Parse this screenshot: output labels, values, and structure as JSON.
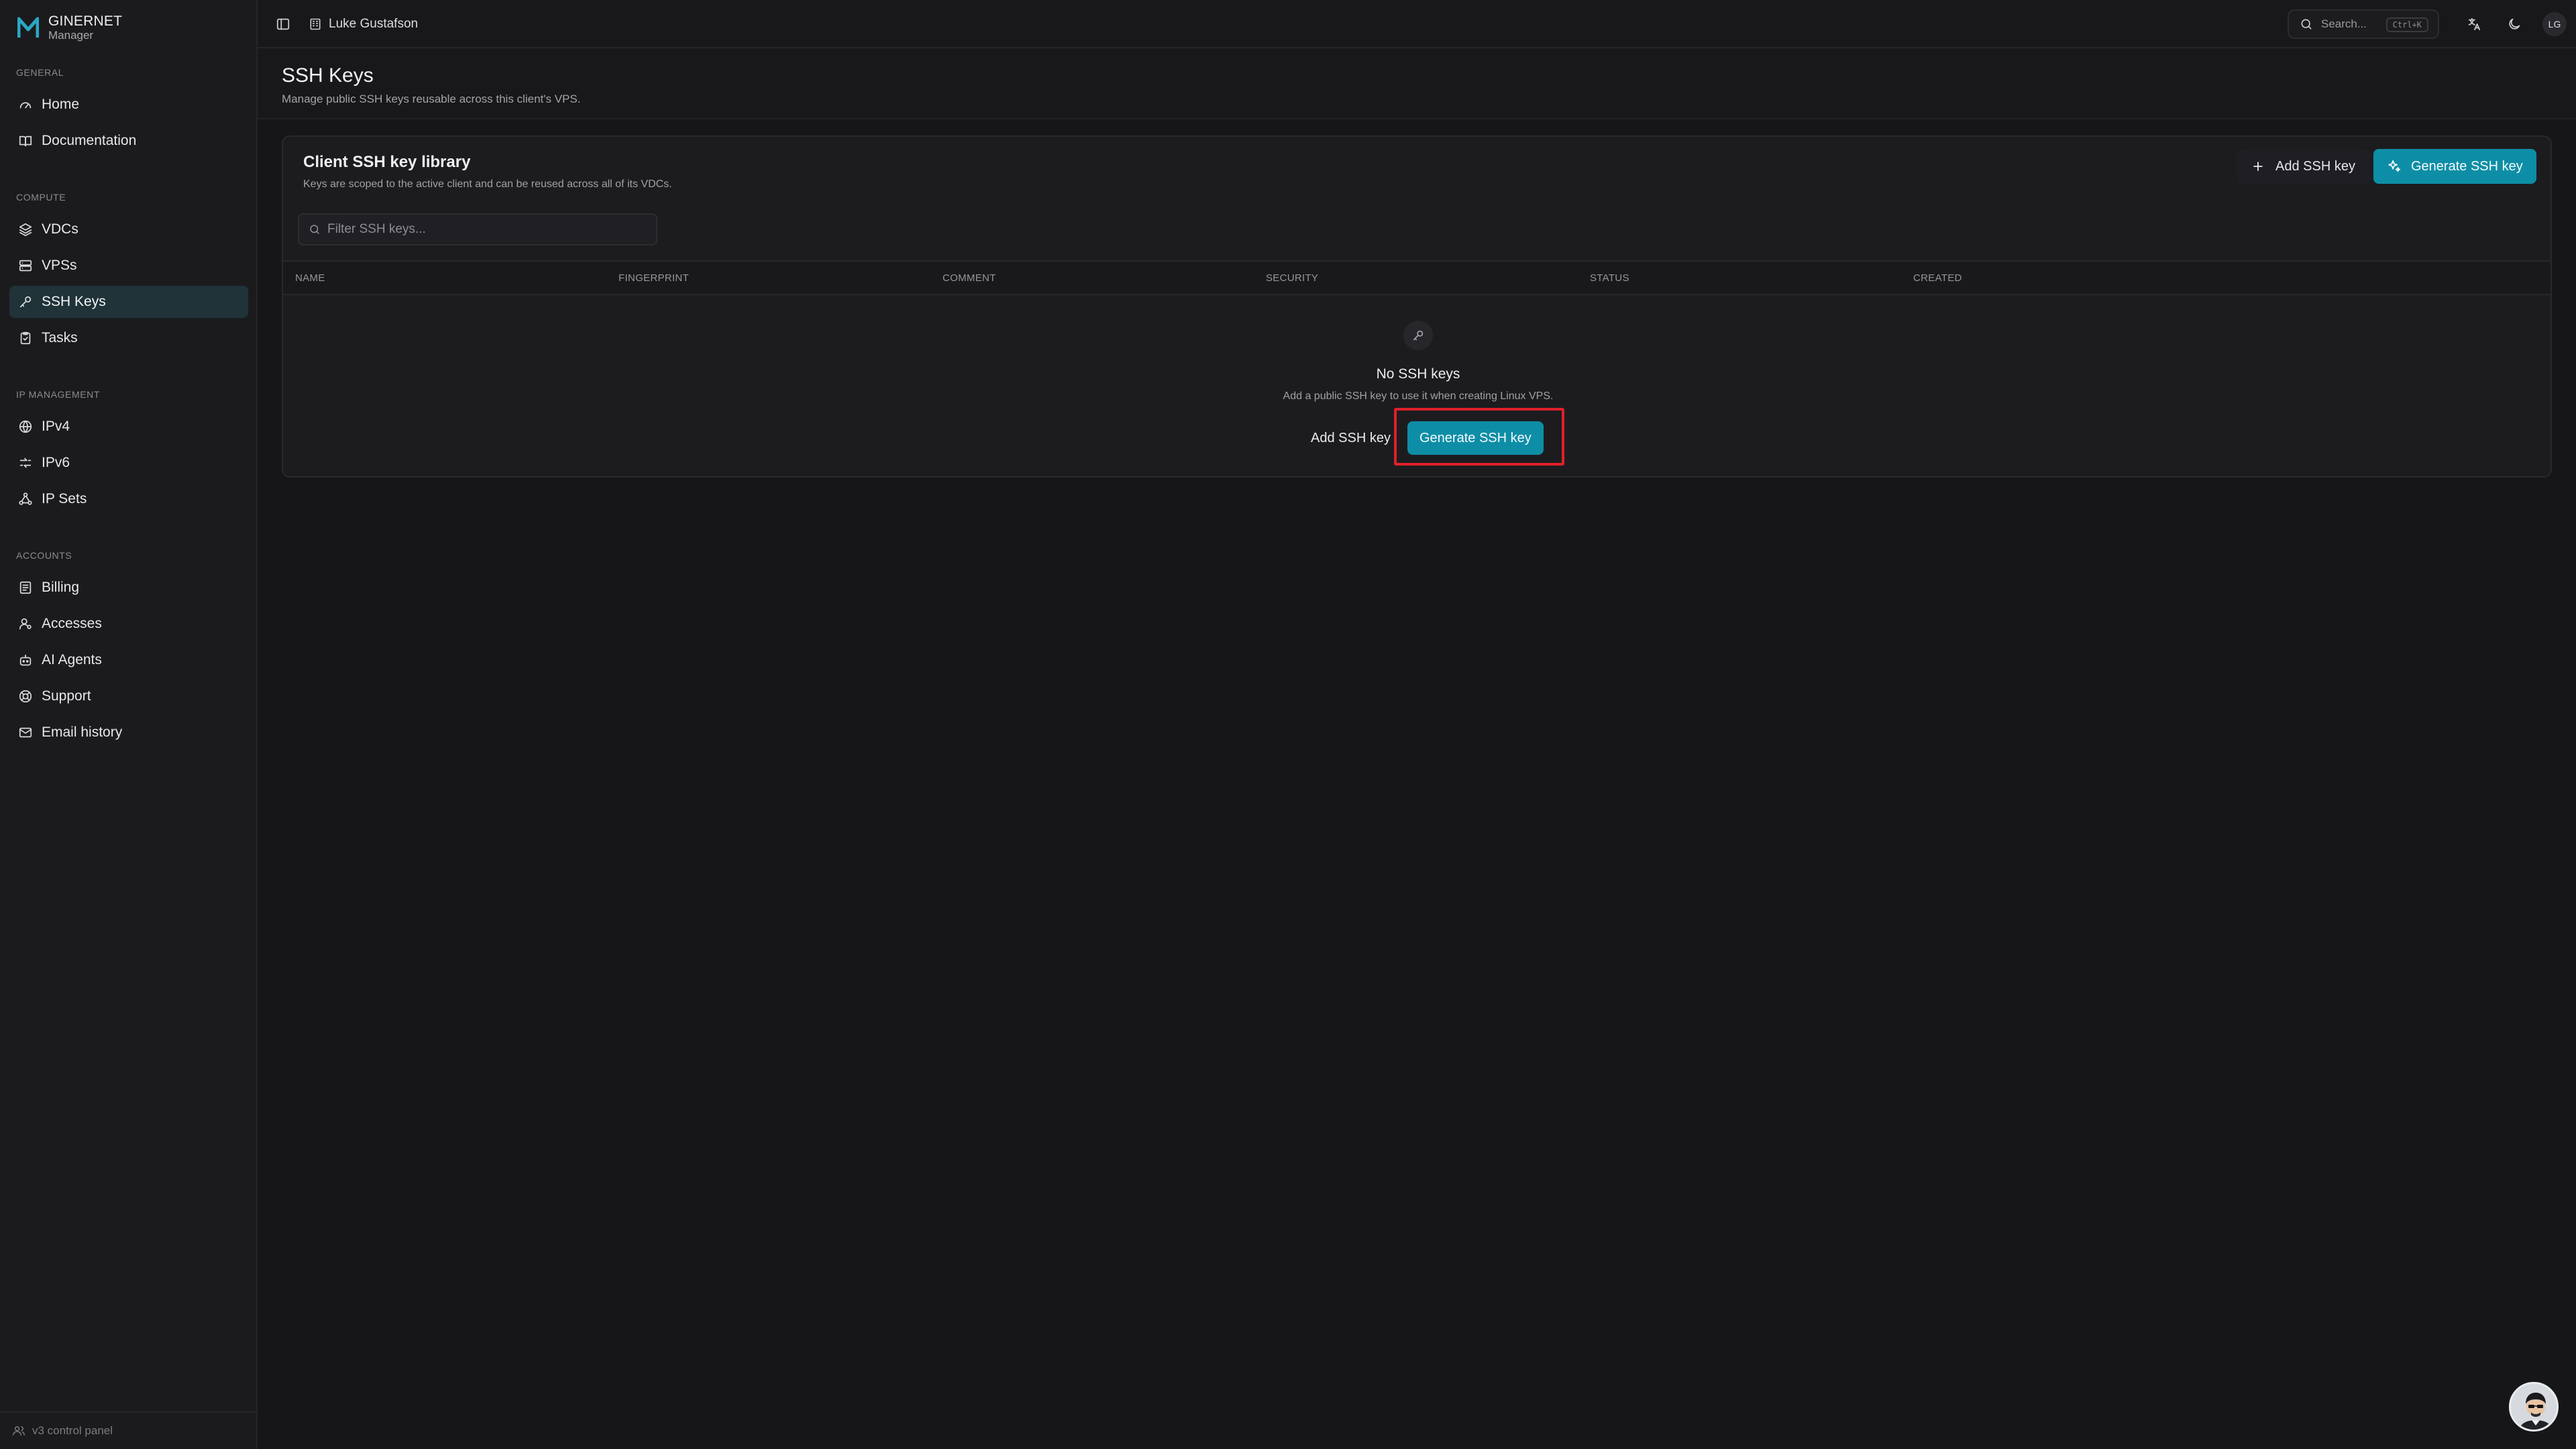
{
  "brand": {
    "name": "GINERNET",
    "sub": "Manager",
    "logo_color": "#2aa7c4"
  },
  "sidebar": {
    "sections": [
      {
        "label": "GENERAL",
        "items": [
          {
            "label": "Home",
            "icon": "gauge-icon"
          },
          {
            "label": "Documentation",
            "icon": "book-icon"
          }
        ]
      },
      {
        "label": "COMPUTE",
        "items": [
          {
            "label": "VDCs",
            "icon": "layers-icon"
          },
          {
            "label": "VPSs",
            "icon": "server-icon"
          },
          {
            "label": "SSH Keys",
            "icon": "key-icon",
            "active": true
          },
          {
            "label": "Tasks",
            "icon": "clipboard-icon"
          }
        ]
      },
      {
        "label": "IP MANAGEMENT",
        "items": [
          {
            "label": "IPv4",
            "icon": "globe-icon"
          },
          {
            "label": "IPv6",
            "icon": "network-icon"
          },
          {
            "label": "IP Sets",
            "icon": "nodes-icon"
          }
        ]
      },
      {
        "label": "ACCOUNTS",
        "items": [
          {
            "label": "Billing",
            "icon": "receipt-icon"
          },
          {
            "label": "Accesses",
            "icon": "user-cog-icon"
          },
          {
            "label": "AI Agents",
            "icon": "bot-icon"
          },
          {
            "label": "Support",
            "icon": "lifebuoy-icon"
          },
          {
            "label": "Email history",
            "icon": "mail-icon"
          }
        ]
      }
    ],
    "footer": "v3 control panel"
  },
  "topbar": {
    "client_name": "Luke Gustafson",
    "search_placeholder": "Search...",
    "search_shortcut": "Ctrl+K",
    "avatar_initials": "LG"
  },
  "page": {
    "title": "SSH Keys",
    "subtitle": "Manage public SSH keys reusable across this client's VPS."
  },
  "card": {
    "title": "Client SSH key library",
    "description": "Keys are scoped to the active client and can be reused across all of its VDCs.",
    "add_button": "Add SSH key",
    "generate_button": "Generate SSH key",
    "filter_placeholder": "Filter SSH keys...",
    "columns": [
      "NAME",
      "FINGERPRINT",
      "COMMENT",
      "SECURITY",
      "STATUS",
      "CREATED"
    ],
    "empty": {
      "title": "No SSH keys",
      "description": "Add a public SSH key to use it when creating Linux VPS.",
      "add_button": "Add SSH key",
      "generate_button": "Generate SSH key"
    }
  },
  "colors": {
    "accent": "#0e8ea6",
    "highlight": "#e0202a",
    "active_nav_bg": "#1f3338"
  }
}
